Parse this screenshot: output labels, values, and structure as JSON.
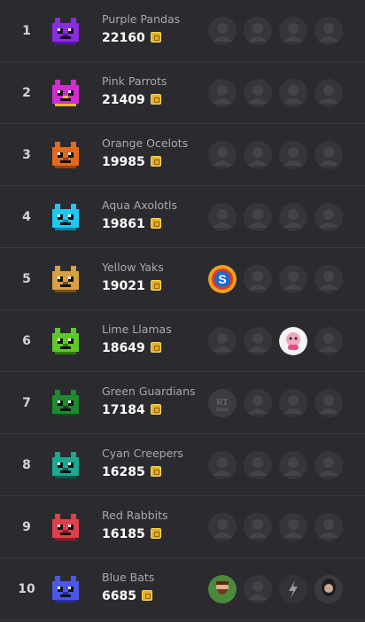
{
  "leaderboard": {
    "teams": [
      {
        "rank": "1",
        "name": "Purple Pandas",
        "points": "22160",
        "color": "#8a2be2",
        "accent": "#5a0fb0",
        "members": [
          "avatar-hooded",
          "avatar-person",
          "avatar-wolf",
          "avatar-box"
        ]
      },
      {
        "rank": "2",
        "name": "Pink Parrots",
        "points": "21409",
        "color": "#d02cd0",
        "accent": "#e0c020",
        "members": [
          "avatar-dark",
          "avatar-pokeball",
          "avatar-bug",
          "avatar-gear"
        ]
      },
      {
        "rank": "3",
        "name": "Orange Ocelots",
        "points": "19985",
        "color": "#e06a20",
        "accent": "#a04010",
        "members": [
          "avatar-glasses",
          "avatar-person",
          "avatar-cartoon",
          "avatar-car"
        ]
      },
      {
        "rank": "4",
        "name": "Aqua Axolotls",
        "points": "19861",
        "color": "#1ec8ee",
        "accent": "#0a7fa8",
        "members": [
          "avatar-robot",
          "avatar-cat",
          "avatar-creature",
          "avatar-person"
        ]
      },
      {
        "rank": "5",
        "name": "Yellow Yaks",
        "points": "19021",
        "color": "#d8a040",
        "accent": "#7a5018",
        "members": [
          "avatar-s-logo",
          "avatar-chevron",
          "avatar-game",
          "avatar-dark"
        ]
      },
      {
        "rank": "6",
        "name": "Lime Llamas",
        "points": "18649",
        "color": "#5ec82a",
        "accent": "#2e7a10",
        "members": [
          "avatar-faded",
          "avatar-person",
          "avatar-pink-character",
          "avatar-glasses"
        ]
      },
      {
        "rank": "7",
        "name": "Green Guardians",
        "points": "17184",
        "color": "#1e8a2e",
        "accent": "#0a4a14",
        "members": [
          "avatar-rt-game",
          "avatar-person",
          "avatar-drop",
          "avatar-dark"
        ]
      },
      {
        "rank": "8",
        "name": "Cyan Creepers",
        "points": "16285",
        "color": "#1aa890",
        "accent": "#0a5a50",
        "members": [
          "avatar-helmet",
          "avatar-bird",
          "avatar-person",
          "avatar-face"
        ]
      },
      {
        "rank": "9",
        "name": "Red Rabbits",
        "points": "16185",
        "color": "#e0404a",
        "accent": "#9a1a24",
        "members": [
          "avatar-faded",
          "avatar-stream",
          "avatar-person",
          "avatar-face"
        ]
      },
      {
        "rank": "10",
        "name": "Blue Bats",
        "points": "6685",
        "color": "#4a58e8",
        "accent": "#2a2aa0",
        "members": [
          "avatar-bearded",
          "avatar-person",
          "avatar-bolt",
          "avatar-woman"
        ]
      }
    ]
  }
}
